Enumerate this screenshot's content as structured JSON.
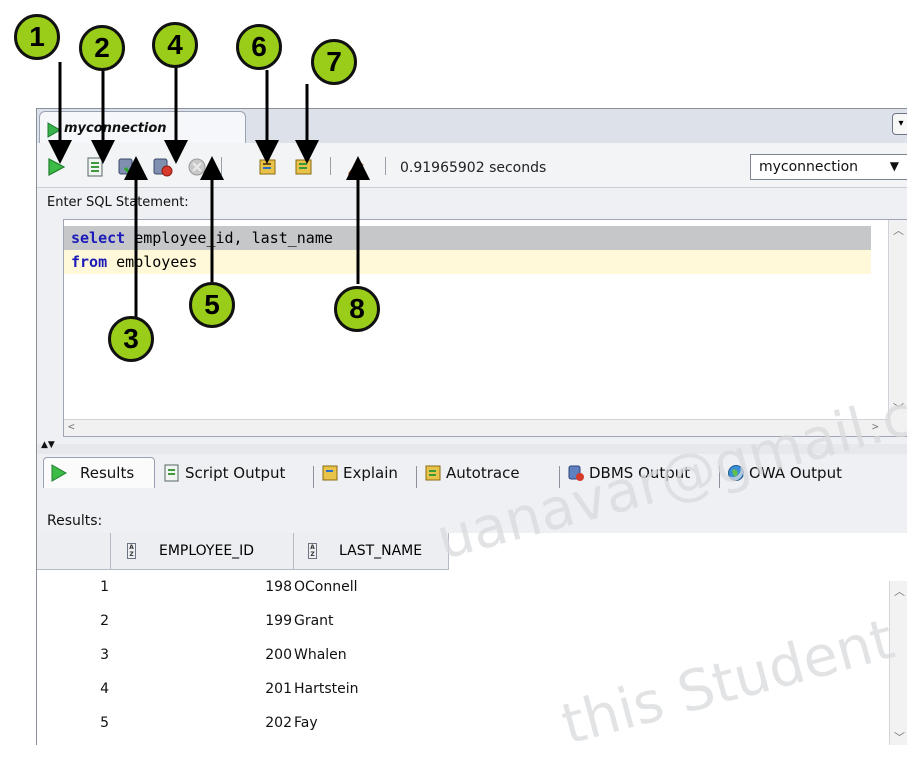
{
  "tab": {
    "title": "myconnection",
    "menu_glyph": "▾"
  },
  "toolbar": {
    "elapsed": "0.91965902 seconds",
    "connection": "myconnection",
    "buttons": {
      "run_statement": "play-icon",
      "run_script": "script-icon",
      "commit": "commit-icon",
      "rollback": "rollback-icon",
      "cancel": "cancel-icon",
      "explain_plan": "explain-icon",
      "autotrace": "autotrace-icon",
      "clear": "eraser-icon"
    }
  },
  "editor": {
    "label": "Enter SQL Statement:",
    "line1_kw": "select",
    "line1_rest": " employee_id, last_name",
    "line2_kw": "from",
    "line2_rest": " employees"
  },
  "results_tabs": {
    "results": "Results",
    "script_output": "Script Output",
    "explain": "Explain",
    "autotrace": "Autotrace",
    "dbms_output": "DBMS Output",
    "owa_output": "OWA Output"
  },
  "results": {
    "label": "Results:",
    "columns": [
      "EMPLOYEE_ID",
      "LAST_NAME"
    ],
    "rows": [
      {
        "n": "1",
        "id": "198",
        "name": "OConnell"
      },
      {
        "n": "2",
        "id": "199",
        "name": "Grant"
      },
      {
        "n": "3",
        "id": "200",
        "name": "Whalen"
      },
      {
        "n": "4",
        "id": "201",
        "name": "Hartstein"
      },
      {
        "n": "5",
        "id": "202",
        "name": "Fay"
      }
    ]
  },
  "watermark": {
    "line1": "uanavar@gmail.com",
    "line2": "this Student G"
  },
  "callouts": [
    "1",
    "2",
    "3",
    "4",
    "5",
    "6",
    "7",
    "8"
  ],
  "colors": {
    "callout_fill": "#9acd1a",
    "keyword": "#1b1bb8",
    "current_line": "#fff8d9",
    "selected_line": "#c6c7c9"
  }
}
